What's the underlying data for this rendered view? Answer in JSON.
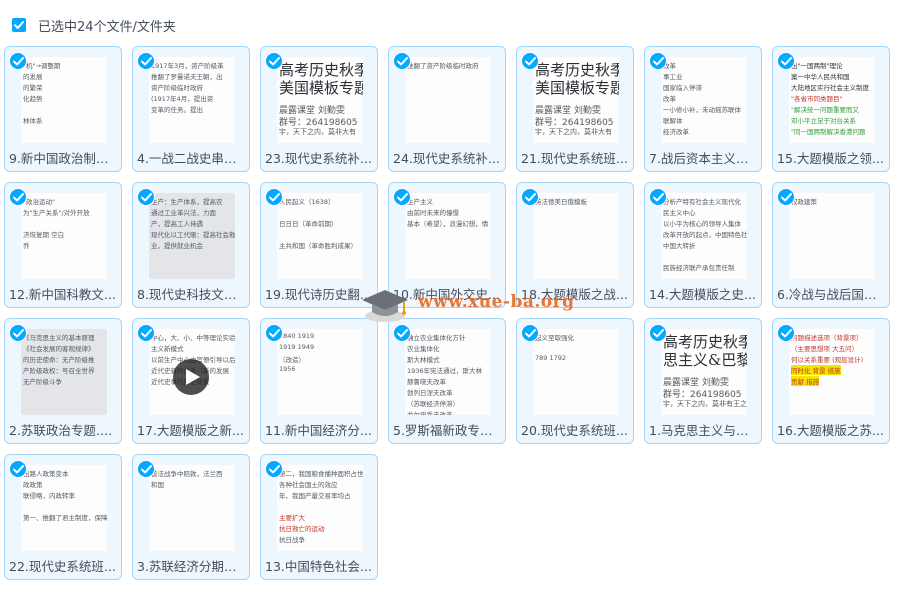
{
  "header": {
    "selected_label": "已选中24个文件/文件夹"
  },
  "watermark": {
    "text": "www.xue-ba.org"
  },
  "files": [
    {
      "name": "9.新中国政治制度...",
      "thumb": [
        "\"机\"→调整期",
        "的发展",
        "的繁荣",
        "化趋势",
        "",
        "林体系"
      ]
    },
    {
      "name": "4.一战二战史串讲...",
      "thumb": [
        "1917年3月，资产阶级革",
        "推翻了罗曼诺夫王朝，出",
        "资产阶级临时政府",
        "(1917年4月，提出资",
        "变革的任务。提出"
      ]
    },
    {
      "name": "23.现代史系统补...",
      "thumb": [
        "高考历史秋季班",
        "美国模板专题",
        "晨露课堂 刘勤雯",
        "群号：264198605",
        "宇，天下之内，莫非大有"
      ]
    },
    {
      "name": "24.现代史系统补...",
      "thumb": [
        "推翻了资产阶级临时政府"
      ]
    },
    {
      "name": "21.现代史系统班...",
      "thumb": [
        "高考历史秋季班",
        "美国模板专题",
        "晨露课堂 刘勤雯",
        "群号：264198605",
        "宇，天下之内，莫非大有"
      ]
    },
    {
      "name": "7.战后资本主义经...",
      "thumb": [
        "改革",
        "事工业",
        "国家临入停滞",
        "改革",
        "一小修小补，未动摇苏联体",
        "联解体",
        "经济改革"
      ]
    },
    {
      "name": "15.大题模版之领...",
      "thumb": [
        "出\"一国两制\"理论",
        "案一中华人民共和国",
        "大陆地区实行社会主义制度",
        "\"各省市同类题目\"",
        "\"解决统一问题重要而又",
        "邓小平立足于对台关系",
        "\"同一国两制解决香港问题"
      ]
    },
    {
      "name": "12.新中国科教文...",
      "thumb": [
        "\"政治运动\"",
        "为\"生产关系\"/对外开放",
        "",
        "济恢复期 空白",
        "乔"
      ]
    },
    {
      "name": "8.现代史科技文艺...",
      "thumb": [
        "生产：生产体系，提高农",
        "通过工业革兴法，力面",
        "产，提高工人待遇",
        "现代化以工代赈：提高社会救",
        "业，提供就业机会"
      ]
    },
    {
      "name": "19.现代诗历史翻...",
      "thumb": [
        "人民起义（1638）",
        "",
        "日日日（革命前期）",
        "",
        "主共和国（革命胜利成果）"
      ]
    },
    {
      "name": "10.新中国外交史...",
      "thumb": [
        "生产主义",
        "由前时未来的憧憬",
        "基本（希望），浪漫幻想，情"
      ]
    },
    {
      "name": "18.大题模版之战...",
      "thumb": [
        "英法德美日俄模板"
      ]
    },
    {
      "name": "14.大题模版之史...",
      "thumb": [
        "分析产特有社会主义现代化",
        "民主义中心",
        "以小平为核心的领导人集体",
        "改革开放的起点，中国特色社会",
        "中国大转折",
        "",
        "民族经济联产承包责任制"
      ]
    },
    {
      "name": "6.冷战与战后国际...",
      "thumb": [
        "权政建策"
      ]
    },
    {
      "name": "2.苏联政治专题.m...",
      "thumb": [
        "《马克思主义的基本原理",
        "《社会发展的客观规律》",
        "的历史使命：无产阶级推",
        "产阶级政权：号召全世界",
        "无产阶级斗争"
      ]
    },
    {
      "name": "17.大题模版之新...",
      "thumb": [
        "中心，大、小、中等理论实验",
        "主义新模式",
        "以前生产中心由官僚引导以后",
        "近代史新的关系（新的发展",
        "近代史事的历史背景"
      ]
    },
    {
      "name": "11.新中国经济分...",
      "thumb": [
        "1840 1919",
        "1919 1949",
        "（改造）",
        "1956"
      ]
    },
    {
      "name": "5.罗斯福新政专题....",
      "thumb": [
        "确立农业集体化方针",
        "农业集体化",
        "斯大林模式",
        "1936年宪法通过，斯大林",
        "赫鲁晓夫改革",
        "勃列日涅夫改革",
        "（苏联经济停滞）",
        "戈尔巴乔夫改革"
      ]
    },
    {
      "name": "20.现代史系统班...",
      "thumb": [
        "起义至取强化",
        "",
        "789 1792"
      ]
    },
    {
      "name": "1.马克思主义与巴...",
      "thumb": [
        "高考历史秋季班",
        "思主义&巴黎公社",
        "晨露课堂 刘勤雯",
        "群号：264198605",
        "宇，天下之内，莫非有王之"
      ]
    },
    {
      "name": "16.大题模版之苏...",
      "thumb": [
        "问题描述选项（背景项）",
        "（主要思想项 大五问）",
        "何以关系重要 (观层设计)",
        "同时化 背景 措施",
        "贡献 措施"
      ]
    },
    {
      "name": "22.现代史系统班...",
      "thumb": [
        "出路人政策变本",
        "政政策",
        "联侵略，内政转率",
        "",
        "第一、推翻了君主制度，保障自由"
      ]
    },
    {
      "name": "3.苏联经济分期专...",
      "thumb": [
        "普法战争中赔款，法兰西",
        "和国"
      ]
    },
    {
      "name": "13.中国特色社会...",
      "thumb": [
        "第二，我国粮食播种面积占世界",
        "各种社会国土的效应",
        "年、我国产量交易率均占",
        "",
        "主要扩大",
        "抗日救亡的运动",
        "抗日战争"
      ]
    }
  ]
}
